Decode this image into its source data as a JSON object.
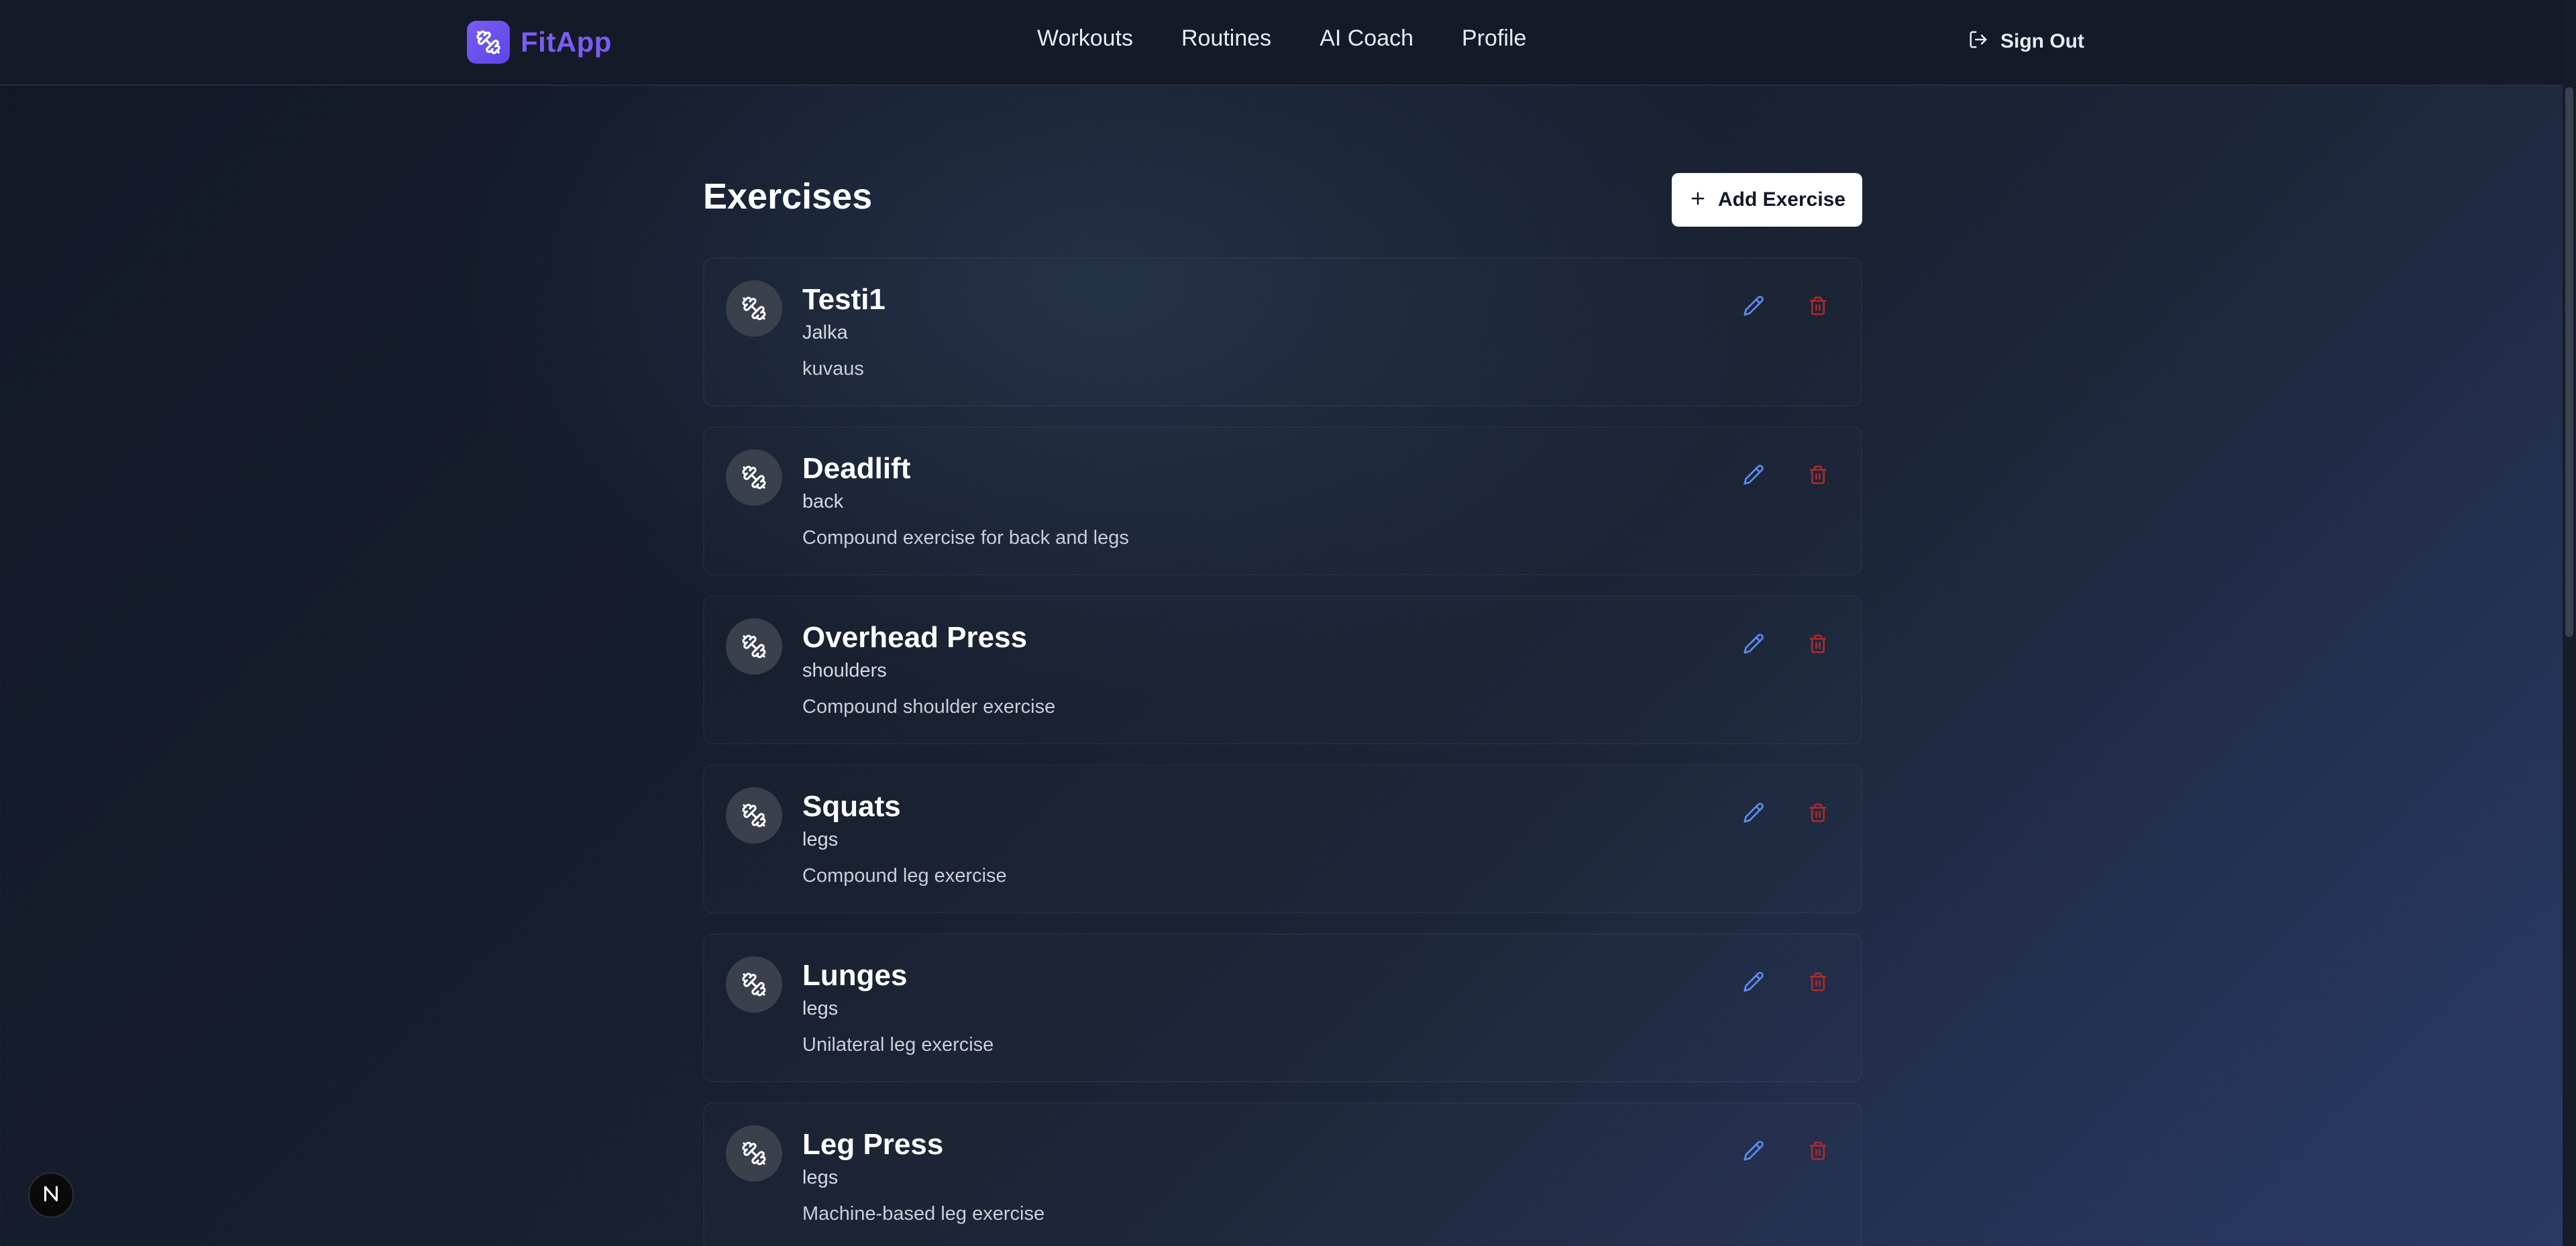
{
  "brand": {
    "name": "FitApp",
    "icon": "dumbbell-icon",
    "color": "#7c5cf7"
  },
  "nav": {
    "items": [
      {
        "label": "Workouts"
      },
      {
        "label": "Routines"
      },
      {
        "label": "AI Coach"
      },
      {
        "label": "Profile"
      }
    ]
  },
  "header": {
    "signout_label": "Sign Out",
    "signout_icon": "log-out-icon"
  },
  "main": {
    "title": "Exercises",
    "add_button_label": "Add Exercise",
    "exercises": [
      {
        "name": "Testi1",
        "muscle": "Jalka",
        "description": "kuvaus"
      },
      {
        "name": "Deadlift",
        "muscle": "back",
        "description": "Compound exercise for back and legs"
      },
      {
        "name": "Overhead Press",
        "muscle": "shoulders",
        "description": "Compound shoulder exercise"
      },
      {
        "name": "Squats",
        "muscle": "legs",
        "description": "Compound leg exercise"
      },
      {
        "name": "Lunges",
        "muscle": "legs",
        "description": "Unilateral leg exercise"
      },
      {
        "name": "Leg Press",
        "muscle": "legs",
        "description": "Machine-based leg exercise"
      }
    ]
  },
  "colors": {
    "accent": "#7c5cf7",
    "edit": "#5b8def",
    "delete": "#b22a2a",
    "button_bg": "#ffffff"
  },
  "dev_badge": {
    "label": "N"
  }
}
